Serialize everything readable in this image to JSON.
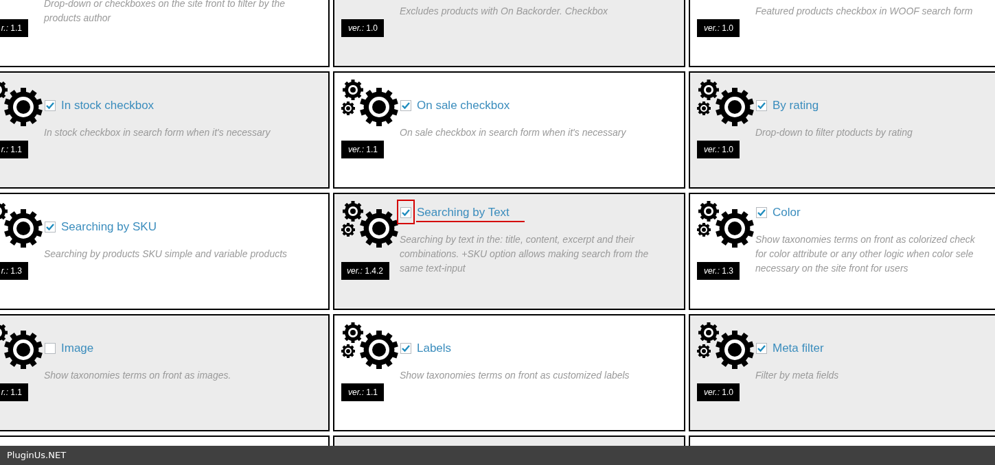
{
  "rows": [
    {
      "cards": [
        {
          "kind": "module",
          "description": [
            "Drop-down or checkboxes on the site front to filter by the",
            "products author"
          ],
          "version": "*r.:* 1.1"
        },
        {
          "kind": "module",
          "description": [
            "Excludes products with On Backorder. Checkbox"
          ],
          "version": "*ver.:* 1.0"
        },
        {
          "kind": "module",
          "description": [
            "Featured products checkbox in WOOF search form"
          ],
          "version": "*ver.:* 1.0"
        }
      ]
    },
    {
      "cards": [
        {
          "kind": "module",
          "title": "In stock checkbox",
          "checked": true,
          "highlighted": false,
          "description": [
            "In stock checkbox in search form when it's necessary"
          ],
          "version": "*r.:* 1.1"
        },
        {
          "kind": "module",
          "title": "On sale checkbox",
          "checked": true,
          "highlighted": false,
          "description": [
            "On sale checkbox in search form when it's necessary"
          ],
          "version": "*ver.:* 1.1"
        },
        {
          "kind": "module",
          "title": "By rating",
          "checked": true,
          "highlighted": false,
          "description": [
            "Drop-down to filter ptoducts by rating"
          ],
          "version": "*ver.:* 1.0"
        }
      ]
    },
    {
      "cards": [
        {
          "kind": "module",
          "title": "Searching by SKU",
          "checked": true,
          "highlighted": false,
          "description": [
            "Searching by products SKU simple and variable products"
          ],
          "version": "*r.:* 1.3"
        },
        {
          "kind": "module",
          "title": "Searching by Text",
          "checked": true,
          "highlighted": true,
          "description": [
            "Searching by text in the: title, content, excerpt and their",
            "combinations. +SKU option allows making search from the",
            "same text-input"
          ],
          "version": "*ver.:* 1.4.2"
        },
        {
          "kind": "module",
          "title": "Color",
          "checked": true,
          "highlighted": false,
          "description": [
            "Show taxonomies terms on front as colorized check",
            "for color attribute or any other logic when color sele",
            "necessary on the site front for users"
          ],
          "version": "*ver.:* 1.3"
        }
      ]
    },
    {
      "cards": [
        {
          "kind": "module",
          "title": "Image",
          "checked": false,
          "highlighted": false,
          "description": [
            "Show taxonomies terms on front as images."
          ],
          "version": "*r.:* 1.1"
        },
        {
          "kind": "module",
          "title": "Labels",
          "checked": true,
          "highlighted": false,
          "description": [
            "Show taxonomies terms on front as customized labels"
          ],
          "version": "*ver.:* 1.1"
        },
        {
          "kind": "module",
          "title": "Meta filter",
          "checked": true,
          "highlighted": false,
          "description": [
            "Filter by meta fields"
          ],
          "version": "*ver.:* 1.0"
        }
      ]
    },
    {
      "cards": [
        {
          "kind": "partial"
        },
        {
          "kind": "partial"
        },
        {
          "kind": "partial"
        }
      ]
    }
  ],
  "footer": {
    "brand": "PluginUs.NET"
  }
}
